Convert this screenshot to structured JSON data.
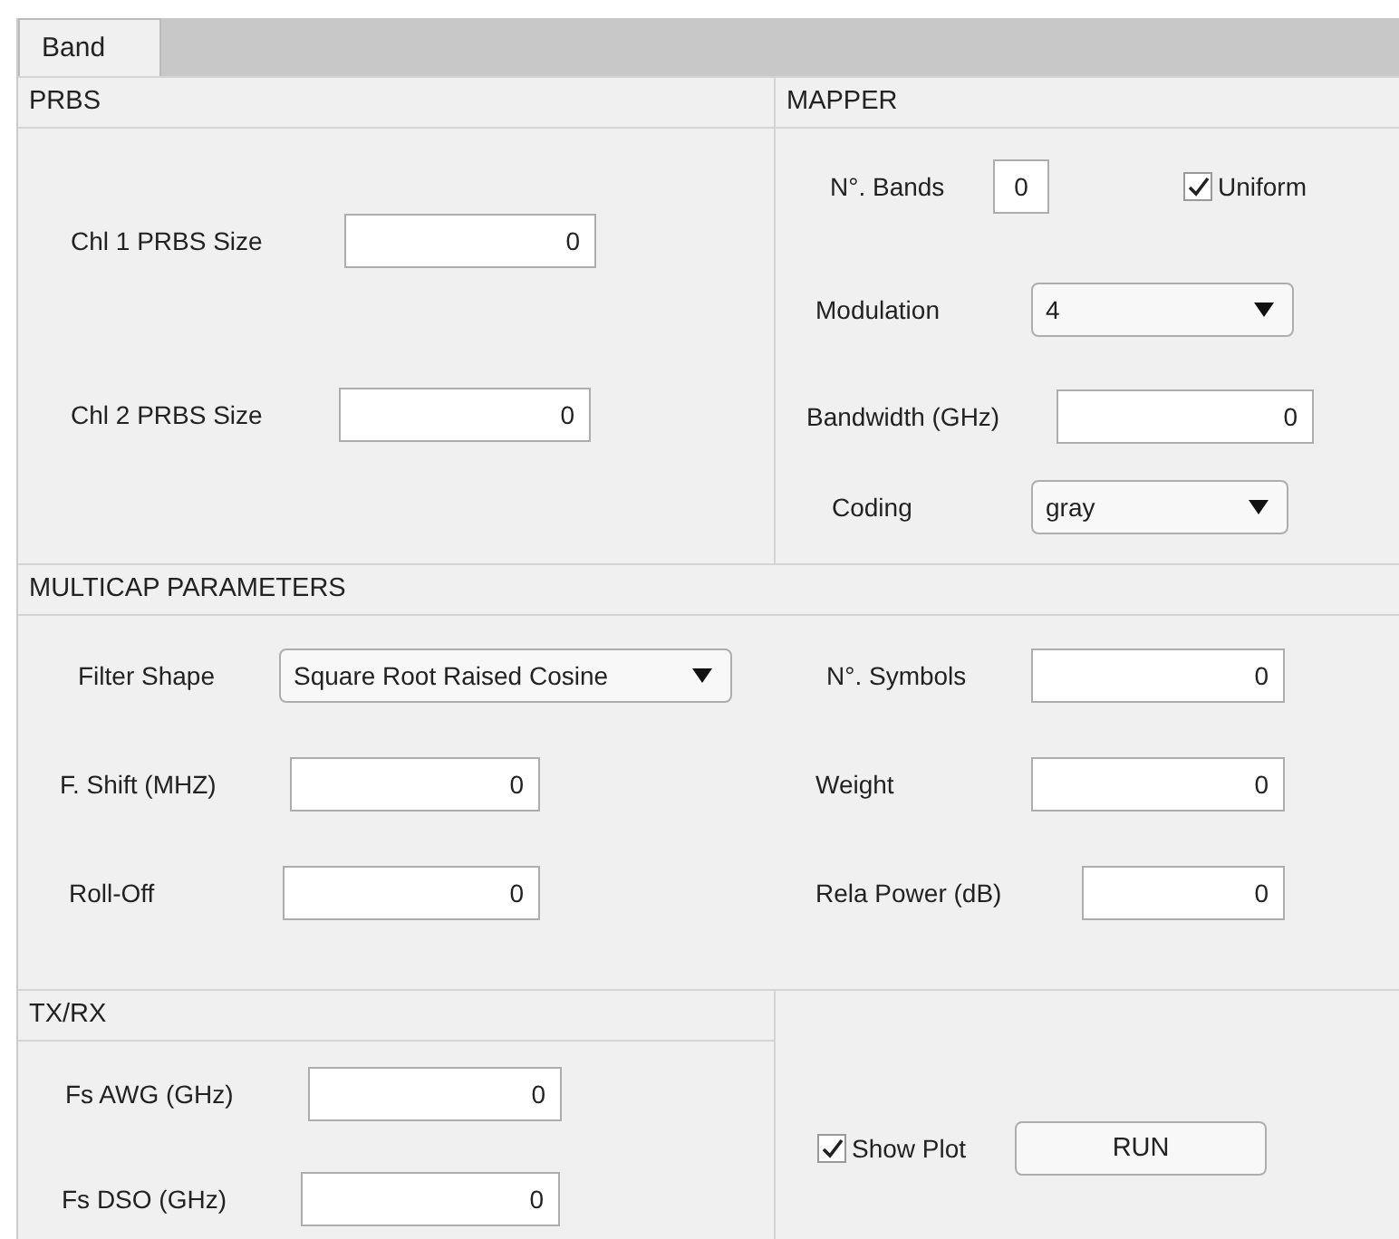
{
  "tabs": [
    {
      "label": "Band",
      "selected": true
    }
  ],
  "prbs": {
    "title": "PRBS",
    "controls": [
      {
        "kind": "field",
        "label": "Chl 1 PRBS Size",
        "value": "0"
      },
      {
        "kind": "field",
        "label": "Chl 2 PRBS Size",
        "value": "0"
      }
    ]
  },
  "mapper": {
    "title": "MAPPER",
    "controls": [
      {
        "kind": "field",
        "label": "N°. Bands",
        "value": "0"
      },
      {
        "kind": "checkbox",
        "label": "Uniform",
        "checked": true
      },
      {
        "kind": "dropdown",
        "label": "Modulation",
        "value": "4"
      },
      {
        "kind": "field",
        "label": "Bandwidth (GHz)",
        "value": "0"
      },
      {
        "kind": "dropdown",
        "label": "Coding",
        "value": "gray"
      }
    ]
  },
  "multicap": {
    "title": "MULTICAP PARAMETERS",
    "controls": [
      {
        "kind": "dropdown",
        "label": "Filter Shape",
        "value": "Square Root Raised Cosine"
      },
      {
        "kind": "field",
        "label": "N°. Symbols",
        "value": "0"
      },
      {
        "kind": "field",
        "label": "F. Shift (MHZ)",
        "value": "0"
      },
      {
        "kind": "field",
        "label": "Weight",
        "value": "0"
      },
      {
        "kind": "field",
        "label": "Roll-Off",
        "value": "0"
      },
      {
        "kind": "field",
        "label": "Rela Power (dB)",
        "value": "0"
      }
    ]
  },
  "txrx": {
    "title": "TX/RX",
    "controls": [
      {
        "kind": "field",
        "label": "Fs AWG (GHz)",
        "value": "0"
      },
      {
        "kind": "field",
        "label": "Fs DSO (GHz)",
        "value": "0"
      }
    ]
  },
  "actions": {
    "controls": [
      {
        "kind": "checkbox",
        "label": "Show Plot",
        "checked": true
      },
      {
        "kind": "button",
        "label": "RUN"
      }
    ]
  }
}
